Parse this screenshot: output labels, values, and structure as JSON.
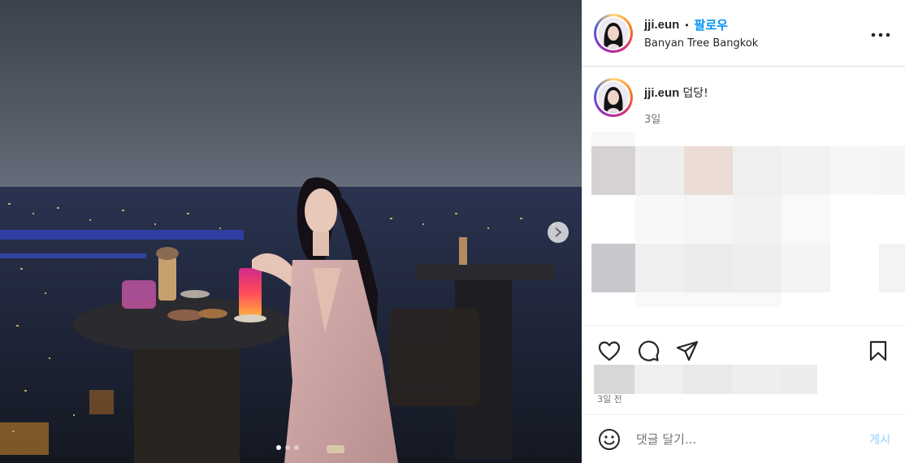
{
  "post": {
    "username": "jji.eun",
    "separator": "•",
    "follow_label": "팔로우",
    "location": "Banyan Tree Bangkok",
    "more_icon": "more-horizontal-icon",
    "caption": {
      "username": "jji.eun",
      "text": "덥당!",
      "time": "3일"
    },
    "date_label": "3일 전",
    "comment_placeholder": "댓글 달기...",
    "post_button": "게시",
    "icons": [
      "heart-icon",
      "comment-icon",
      "share-icon",
      "bookmark-icon",
      "emoji-icon",
      "next-arrow-icon"
    ],
    "carousel": {
      "slides": 3,
      "active": 1
    },
    "colors": {
      "follow": "#0095f6",
      "post_button": "#b2dffc",
      "text": "#262626",
      "muted": "#737373"
    }
  }
}
